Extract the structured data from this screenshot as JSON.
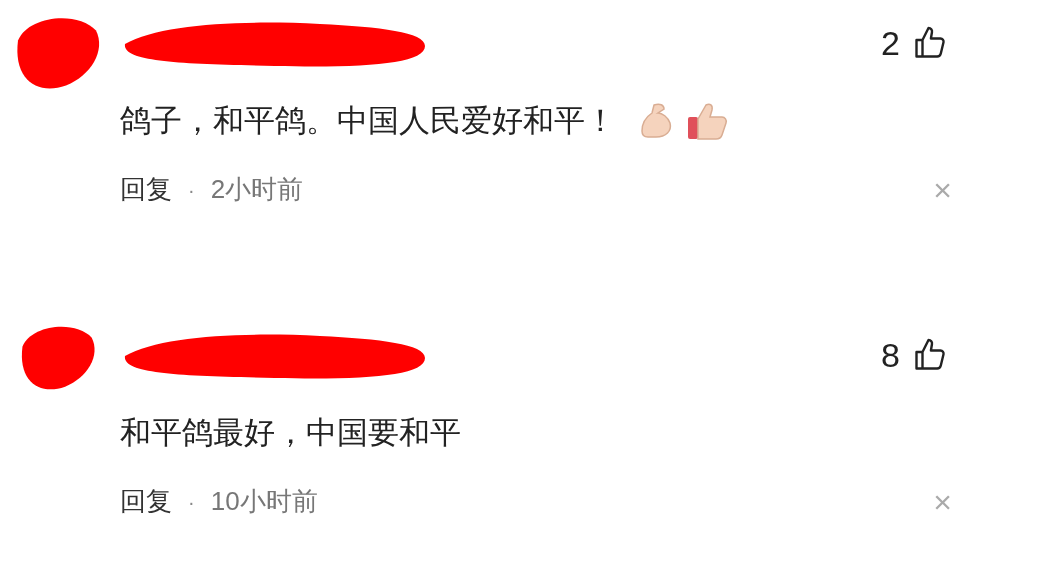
{
  "comments": [
    {
      "text": "鸽子，和平鸽。中国人民爱好和平！",
      "emoji": [
        {
          "kind": "muscle"
        },
        {
          "kind": "thumbs_up"
        }
      ],
      "likes": "2",
      "reply": "回复",
      "separator": "·",
      "time": "2小时前",
      "close": "×"
    },
    {
      "text": "和平鸽最好，中国要和平",
      "likes": "8",
      "reply": "回复",
      "separator": "·",
      "time": "10小时前",
      "close": "×"
    }
  ]
}
